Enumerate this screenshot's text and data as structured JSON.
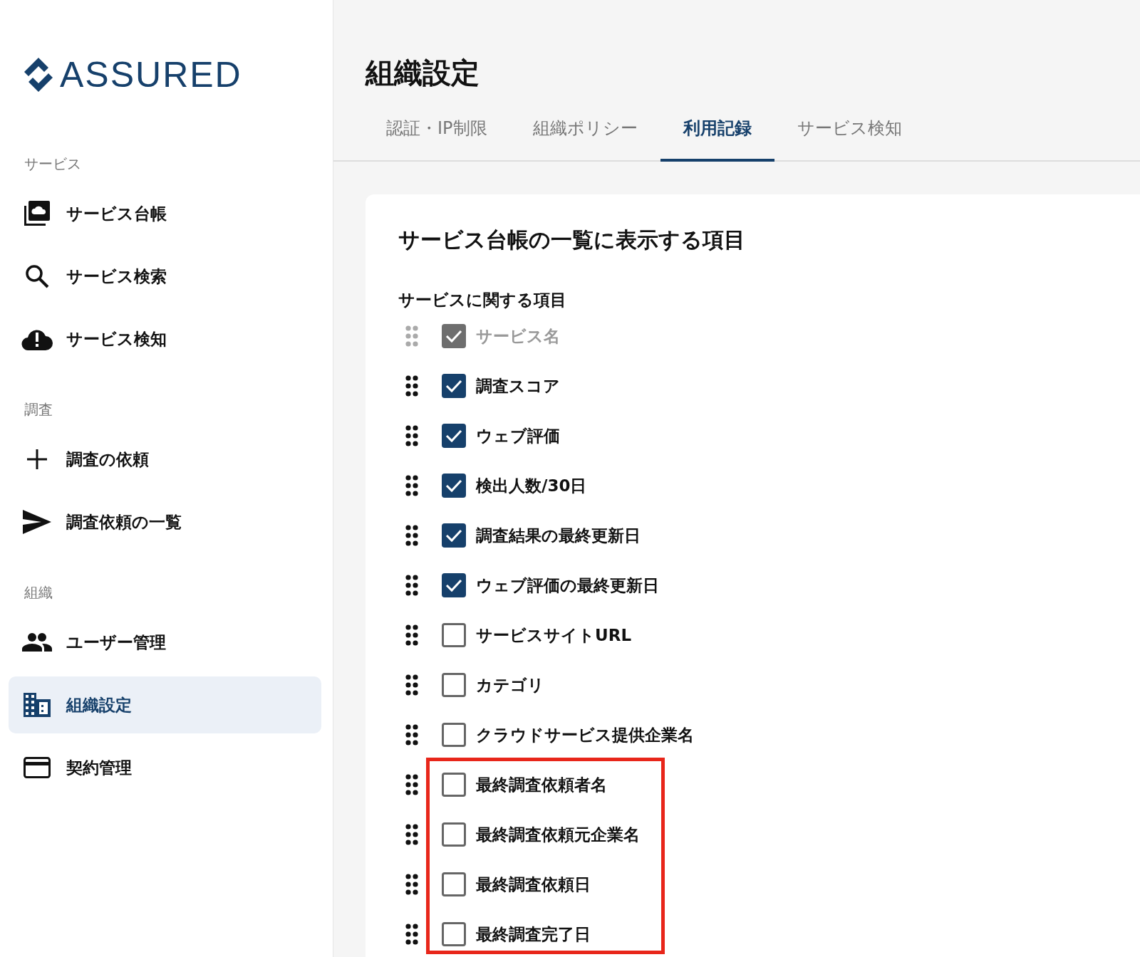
{
  "logo": {
    "text": "ASSURED"
  },
  "sidebar": {
    "sections": [
      {
        "title": "サービス",
        "items": [
          {
            "label": "サービス台帳",
            "kind": "ledger",
            "selected": false
          },
          {
            "label": "サービス検索",
            "kind": "search",
            "selected": false
          },
          {
            "label": "サービス検知",
            "kind": "alert",
            "selected": false
          }
        ]
      },
      {
        "title": "調査",
        "items": [
          {
            "label": "調査の依頼",
            "kind": "add",
            "selected": false
          },
          {
            "label": "調査依頼の一覧",
            "kind": "send",
            "selected": false
          }
        ]
      },
      {
        "title": "組織",
        "items": [
          {
            "label": "ユーザー管理",
            "kind": "users",
            "selected": false
          },
          {
            "label": "組織設定",
            "kind": "building",
            "selected": true
          },
          {
            "label": "契約管理",
            "kind": "card",
            "selected": false
          }
        ]
      }
    ]
  },
  "page": {
    "title": "組織設定"
  },
  "tabs": [
    {
      "label": "認証・IP制限",
      "selected": false
    },
    {
      "label": "組織ポリシー",
      "selected": false
    },
    {
      "label": "利用記録",
      "selected": true
    },
    {
      "label": "サービス検知",
      "selected": false
    }
  ],
  "card": {
    "title": "サービス台帳の一覧に表示する項目",
    "section": "サービスに関する項目",
    "items": [
      {
        "label": "サービス名",
        "checked": true,
        "disabled": true,
        "highlighted": false
      },
      {
        "label": "調査スコア",
        "checked": true,
        "disabled": false,
        "highlighted": false
      },
      {
        "label": "ウェブ評価",
        "checked": true,
        "disabled": false,
        "highlighted": false
      },
      {
        "label": "検出人数/30日",
        "checked": true,
        "disabled": false,
        "highlighted": false
      },
      {
        "label": "調査結果の最終更新日",
        "checked": true,
        "disabled": false,
        "highlighted": false
      },
      {
        "label": "ウェブ評価の最終更新日",
        "checked": true,
        "disabled": false,
        "highlighted": false
      },
      {
        "label": "サービスサイトURL",
        "checked": false,
        "disabled": false,
        "highlighted": false
      },
      {
        "label": "カテゴリ",
        "checked": false,
        "disabled": false,
        "highlighted": false
      },
      {
        "label": "クラウドサービス提供企業名",
        "checked": false,
        "disabled": false,
        "highlighted": false
      },
      {
        "label": "最終調査依頼者名",
        "checked": false,
        "disabled": false,
        "highlighted": true
      },
      {
        "label": "最終調査依頼元企業名",
        "checked": false,
        "disabled": false,
        "highlighted": true
      },
      {
        "label": "最終調査依頼日",
        "checked": false,
        "disabled": false,
        "highlighted": true
      },
      {
        "label": "最終調査完了日",
        "checked": false,
        "disabled": false,
        "highlighted": true
      }
    ]
  }
}
